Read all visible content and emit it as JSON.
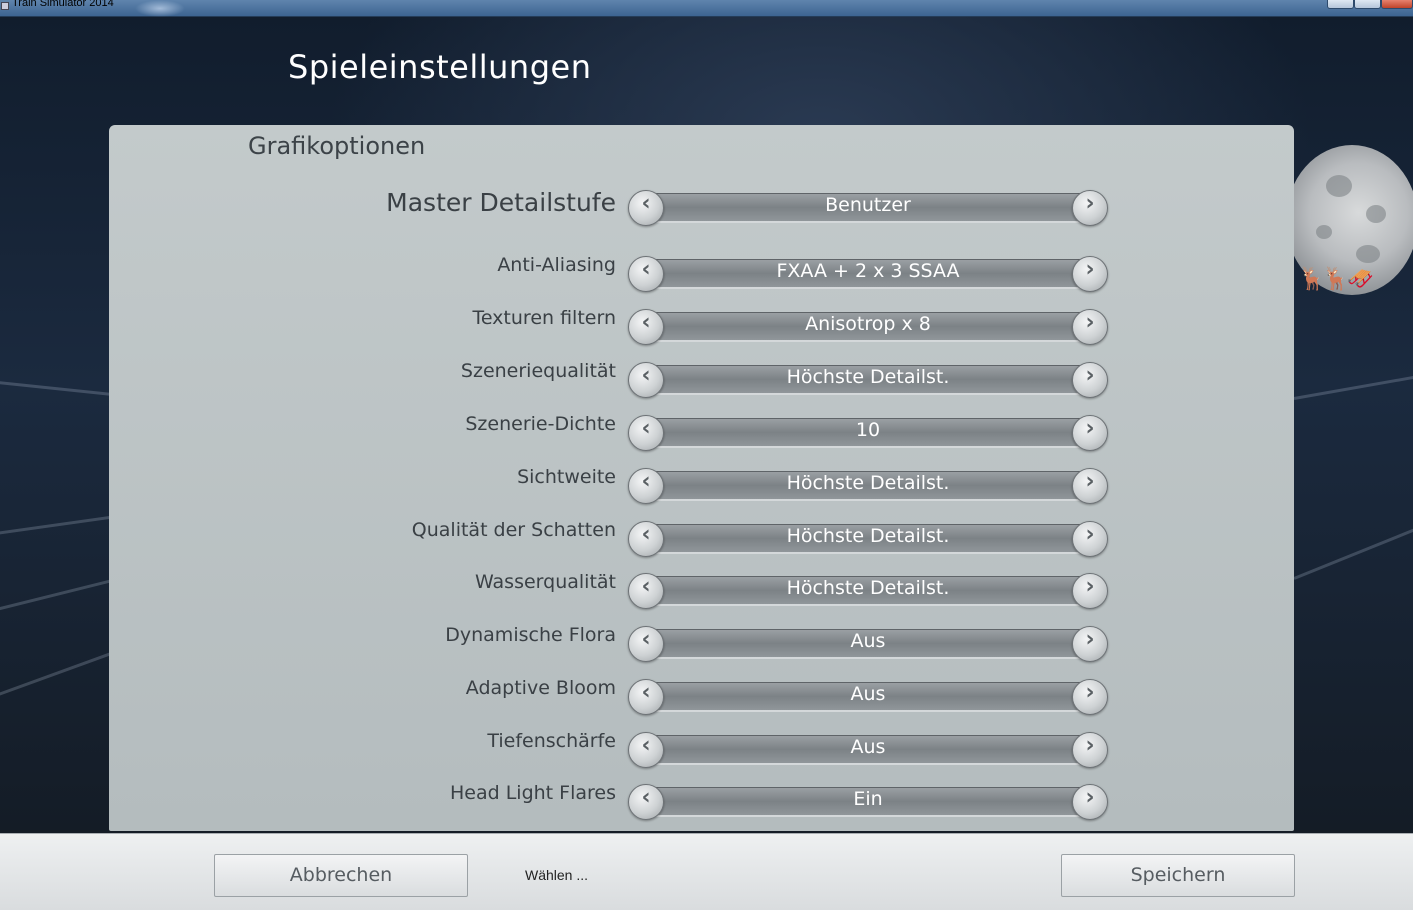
{
  "window": {
    "title": "Train Simulator 2014"
  },
  "page": {
    "title": "Spieleinstellungen"
  },
  "panel": {
    "section_title": "Grafikoptionen",
    "rows": [
      {
        "label": "Master Detailstufe",
        "value": "Benutzer"
      },
      {
        "label": "Anti-Aliasing",
        "value": "FXAA + 2 x 3 SSAA"
      },
      {
        "label": "Texturen filtern",
        "value": "Anisotrop x 8"
      },
      {
        "label": "Szeneriequalität",
        "value": "Höchste Detailst."
      },
      {
        "label": "Szenerie-Dichte",
        "value": "10"
      },
      {
        "label": "Sichtweite",
        "value": "Höchste Detailst."
      },
      {
        "label": "Qualität der Schatten",
        "value": "Höchste Detailst."
      },
      {
        "label": "Wasserqualität",
        "value": "Höchste Detailst."
      },
      {
        "label": "Dynamische Flora",
        "value": "Aus"
      },
      {
        "label": "Adaptive Bloom",
        "value": "Aus"
      },
      {
        "label": "Tiefenschärfe",
        "value": "Aus"
      },
      {
        "label": "Head Light Flares",
        "value": "Ein"
      }
    ]
  },
  "icons": {
    "prev": "chevron-left-icon",
    "next": "chevron-right-icon"
  },
  "bottom": {
    "cancel_label": "Abbrechen",
    "hint": "Wählen ...",
    "save_label": "Speichern"
  }
}
